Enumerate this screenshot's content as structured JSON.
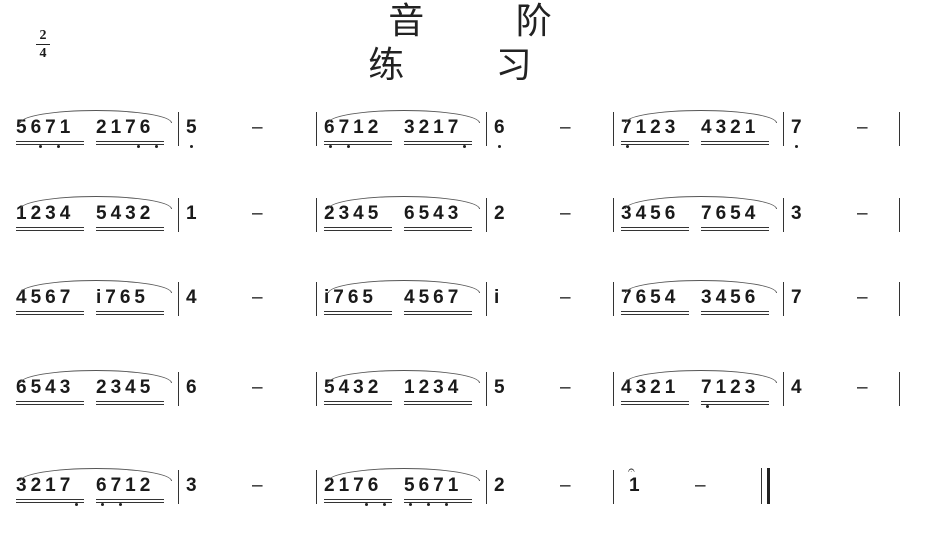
{
  "title": "音 阶 练 习",
  "time_signature": {
    "top": "2",
    "bottom": "4"
  },
  "rows": [
    {
      "measures": [
        {
          "groups": [
            {
              "notes": "5671",
              "dots_low": [
                1,
                2
              ]
            },
            {
              "notes": "2176",
              "dots_low": [
                2,
                3
              ]
            }
          ],
          "single": "5",
          "single_dot_low": true,
          "dash": "–"
        },
        {
          "groups": [
            {
              "notes": "6712",
              "dots_low": [
                0,
                1
              ]
            },
            {
              "notes": "3217",
              "dots_low": [
                3
              ]
            }
          ],
          "single": "6",
          "single_dot_low": true,
          "dash": "–"
        },
        {
          "groups": [
            {
              "notes": "7123",
              "dots_low": [
                0
              ]
            },
            {
              "notes": "4321",
              "dots_low": []
            }
          ],
          "single": "7",
          "single_dot_low": true,
          "dash": "–"
        }
      ]
    },
    {
      "measures": [
        {
          "groups": [
            {
              "notes": "1234",
              "dots_low": []
            },
            {
              "notes": "5432",
              "dots_low": []
            }
          ],
          "single": "1",
          "single_dot_low": false,
          "dash": "–"
        },
        {
          "groups": [
            {
              "notes": "2345",
              "dots_low": []
            },
            {
              "notes": "6543",
              "dots_low": []
            }
          ],
          "single": "2",
          "single_dot_low": false,
          "dash": "–"
        },
        {
          "groups": [
            {
              "notes": "3456",
              "dots_low": []
            },
            {
              "notes": "7654",
              "dots_low": []
            }
          ],
          "single": "3",
          "single_dot_low": false,
          "dash": "–"
        }
      ]
    },
    {
      "measures": [
        {
          "groups": [
            {
              "notes": "4567",
              "dots_low": []
            },
            {
              "notes": "i765",
              "dots_low": []
            }
          ],
          "single": "4",
          "single_dot_low": false,
          "dash": "–"
        },
        {
          "groups": [
            {
              "notes": "i765",
              "dots_low": []
            },
            {
              "notes": "4567",
              "dots_low": []
            }
          ],
          "single": "i",
          "single_dot_low": false,
          "dash": "–"
        },
        {
          "groups": [
            {
              "notes": "7654",
              "dots_low": []
            },
            {
              "notes": "3456",
              "dots_low": []
            }
          ],
          "single": "7",
          "single_dot_low": false,
          "dash": "–"
        }
      ]
    },
    {
      "measures": [
        {
          "groups": [
            {
              "notes": "6543",
              "dots_low": []
            },
            {
              "notes": "2345",
              "dots_low": []
            }
          ],
          "single": "6",
          "single_dot_low": false,
          "dash": "–"
        },
        {
          "groups": [
            {
              "notes": "5432",
              "dots_low": []
            },
            {
              "notes": "1234",
              "dots_low": []
            }
          ],
          "single": "5",
          "single_dot_low": false,
          "dash": "–"
        },
        {
          "groups": [
            {
              "notes": "4321",
              "dots_low": []
            },
            {
              "notes": "7123",
              "dots_low": [
                0
              ]
            }
          ],
          "single": "4",
          "single_dot_low": false,
          "dash": "–"
        }
      ]
    },
    {
      "measures": [
        {
          "groups": [
            {
              "notes": "3217",
              "dots_low": [
                3
              ]
            },
            {
              "notes": "6712",
              "dots_low": [
                0,
                1
              ]
            }
          ],
          "single": "3",
          "single_dot_low": false,
          "dash": "–"
        },
        {
          "groups": [
            {
              "notes": "2176",
              "dots_low": [
                2,
                3
              ]
            },
            {
              "notes": "5671",
              "dots_low": [
                0,
                1,
                2
              ]
            }
          ],
          "single": "2",
          "single_dot_low": false,
          "dash": "–"
        },
        {
          "groups": [],
          "single": "1",
          "single_dot_low": false,
          "dash": "–",
          "fermata": "𝄐",
          "final": true
        }
      ]
    }
  ]
}
